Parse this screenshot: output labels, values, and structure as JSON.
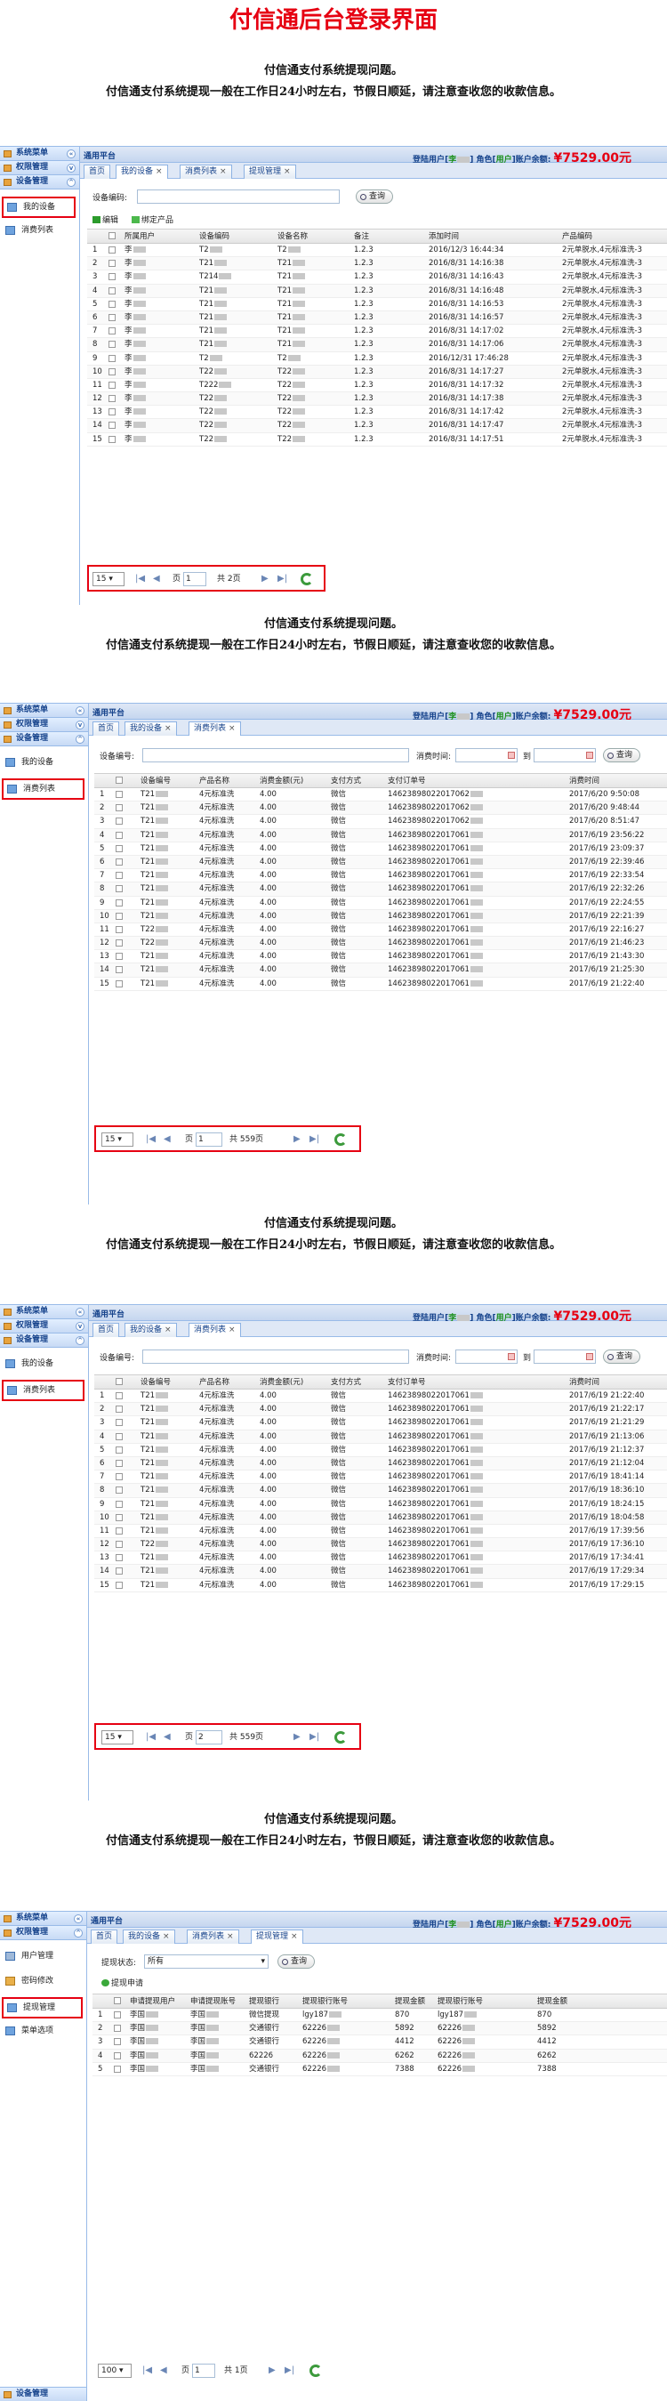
{
  "title": "付信通后台登录界面",
  "notice": {
    "line1": "付信通支付系统提现问题。",
    "line2": "付信通支付系统提现一般在工作日24小时左右，节假日顺延，请注意查收您的收款信息。"
  },
  "header": {
    "platform": "通用平台",
    "login_user_label": "登陆用户",
    "user_name": "李",
    "role_label": "角色",
    "role_name": "用户",
    "balance_label": "账户余额:",
    "balance": "¥7529.00",
    "currency_unit": "元"
  },
  "sidebar": {
    "system_menu": "系统菜单",
    "perm_mgmt": "权限管理",
    "device_mgmt": "设备管理",
    "my_devices": "我的设备",
    "consume_list": "消费列表",
    "user_mgmt": "用户管理",
    "pwd_change": "密码修改",
    "withdraw_mgmt": "提现管理",
    "menu_options": "菜单选项"
  },
  "tabs": {
    "home": "首页",
    "my_devices": "我的设备",
    "consume_list": "消费列表",
    "withdraw_mgmt": "提现管理"
  },
  "panel1": {
    "filter_label": "设备编码:",
    "query_btn": "查询",
    "edit_btn": "编辑",
    "bind_btn": "绑定产品",
    "columns": [
      "所属用户",
      "设备编码",
      "设备名称",
      "备注",
      "添加时间",
      "产品编码"
    ],
    "rows": [
      [
        "1",
        "李",
        "T2",
        "T2",
        "1.2.3",
        "2016/12/3 16:44:34",
        "2元单脱水,4元标准洗-3"
      ],
      [
        "2",
        "李",
        "T21",
        "T21",
        "1.2.3",
        "2016/8/31 14:16:38",
        "2元单脱水,4元标准洗-3"
      ],
      [
        "3",
        "李",
        "T214",
        "T21",
        "1.2.3",
        "2016/8/31 14:16:43",
        "2元单脱水,4元标准洗-3"
      ],
      [
        "4",
        "李",
        "T21",
        "T21",
        "1.2.3",
        "2016/8/31 14:16:48",
        "2元单脱水,4元标准洗-3"
      ],
      [
        "5",
        "李",
        "T21",
        "T21",
        "1.2.3",
        "2016/8/31 14:16:53",
        "2元单脱水,4元标准洗-3"
      ],
      [
        "6",
        "李",
        "T21",
        "T21",
        "1.2.3",
        "2016/8/31 14:16:57",
        "2元单脱水,4元标准洗-3"
      ],
      [
        "7",
        "李",
        "T21",
        "T21",
        "1.2.3",
        "2016/8/31 14:17:02",
        "2元单脱水,4元标准洗-3"
      ],
      [
        "8",
        "李",
        "T21",
        "T21",
        "1.2.3",
        "2016/8/31 14:17:06",
        "2元单脱水,4元标准洗-3"
      ],
      [
        "9",
        "李",
        "T2",
        "T2",
        "1.2.3",
        "2016/12/31 17:46:28",
        "2元单脱水,4元标准洗-3"
      ],
      [
        "10",
        "李",
        "T22",
        "T22",
        "1.2.3",
        "2016/8/31 14:17:27",
        "2元单脱水,4元标准洗-3"
      ],
      [
        "11",
        "李",
        "T222",
        "T22",
        "1.2.3",
        "2016/8/31 14:17:32",
        "2元单脱水,4元标准洗-3"
      ],
      [
        "12",
        "李",
        "T22",
        "T22",
        "1.2.3",
        "2016/8/31 14:17:38",
        "2元单脱水,4元标准洗-3"
      ],
      [
        "13",
        "李",
        "T22",
        "T22",
        "1.2.3",
        "2016/8/31 14:17:42",
        "2元单脱水,4元标准洗-3"
      ],
      [
        "14",
        "李",
        "T22",
        "T22",
        "1.2.3",
        "2016/8/31 14:17:47",
        "2元单脱水,4元标准洗-3"
      ],
      [
        "15",
        "李",
        "T22",
        "T22",
        "1.2.3",
        "2016/8/31 14:17:51",
        "2元单脱水,4元标准洗-3"
      ]
    ],
    "pager": {
      "size": "15",
      "page_label": "页",
      "page": "1",
      "total": "共 2页"
    }
  },
  "consume": {
    "filter_label": "设备编号:",
    "time_label": "消费时间:",
    "to_label": "到",
    "query_btn": "查询",
    "columns": [
      "设备编号",
      "产品名称",
      "消费金额(元)",
      "支付方式",
      "支付订单号",
      "消费时间"
    ]
  },
  "panel2": {
    "rows": [
      [
        "1",
        "T21",
        "4元标准洗",
        "4.00",
        "微信",
        "14623898022017062",
        "2017/6/20 9:50:08"
      ],
      [
        "2",
        "T21",
        "4元标准洗",
        "4.00",
        "微信",
        "14623898022017062",
        "2017/6/20 9:48:44"
      ],
      [
        "3",
        "T21",
        "4元标准洗",
        "4.00",
        "微信",
        "14623898022017062",
        "2017/6/20 8:51:47"
      ],
      [
        "4",
        "T21",
        "4元标准洗",
        "4.00",
        "微信",
        "14623898022017061",
        "2017/6/19 23:56:22"
      ],
      [
        "5",
        "T21",
        "4元标准洗",
        "4.00",
        "微信",
        "14623898022017061",
        "2017/6/19 23:09:37"
      ],
      [
        "6",
        "T21",
        "4元标准洗",
        "4.00",
        "微信",
        "14623898022017061",
        "2017/6/19 22:39:46"
      ],
      [
        "7",
        "T21",
        "4元标准洗",
        "4.00",
        "微信",
        "14623898022017061",
        "2017/6/19 22:33:54"
      ],
      [
        "8",
        "T21",
        "4元标准洗",
        "4.00",
        "微信",
        "14623898022017061",
        "2017/6/19 22:32:26"
      ],
      [
        "9",
        "T21",
        "4元标准洗",
        "4.00",
        "微信",
        "14623898022017061",
        "2017/6/19 22:24:55"
      ],
      [
        "10",
        "T21",
        "4元标准洗",
        "4.00",
        "微信",
        "14623898022017061",
        "2017/6/19 22:21:39"
      ],
      [
        "11",
        "T22",
        "4元标准洗",
        "4.00",
        "微信",
        "14623898022017061",
        "2017/6/19 22:16:27"
      ],
      [
        "12",
        "T22",
        "4元标准洗",
        "4.00",
        "微信",
        "14623898022017061",
        "2017/6/19 21:46:23"
      ],
      [
        "13",
        "T21",
        "4元标准洗",
        "4.00",
        "微信",
        "14623898022017061",
        "2017/6/19 21:43:30"
      ],
      [
        "14",
        "T21",
        "4元标准洗",
        "4.00",
        "微信",
        "14623898022017061",
        "2017/6/19 21:25:30"
      ],
      [
        "15",
        "T21",
        "4元标准洗",
        "4.00",
        "微信",
        "14623898022017061",
        "2017/6/19 21:22:40"
      ]
    ],
    "pager": {
      "size": "15",
      "page_label": "页",
      "page": "1",
      "total": "共 559页"
    }
  },
  "panel3": {
    "rows": [
      [
        "1",
        "T21",
        "4元标准洗",
        "4.00",
        "微信",
        "14623898022017061",
        "2017/6/19 21:22:40"
      ],
      [
        "2",
        "T21",
        "4元标准洗",
        "4.00",
        "微信",
        "14623898022017061",
        "2017/6/19 21:22:17"
      ],
      [
        "3",
        "T21",
        "4元标准洗",
        "4.00",
        "微信",
        "14623898022017061",
        "2017/6/19 21:21:29"
      ],
      [
        "4",
        "T21",
        "4元标准洗",
        "4.00",
        "微信",
        "14623898022017061",
        "2017/6/19 21:13:06"
      ],
      [
        "5",
        "T21",
        "4元标准洗",
        "4.00",
        "微信",
        "14623898022017061",
        "2017/6/19 21:12:37"
      ],
      [
        "6",
        "T21",
        "4元标准洗",
        "4.00",
        "微信",
        "14623898022017061",
        "2017/6/19 21:12:04"
      ],
      [
        "7",
        "T21",
        "4元标准洗",
        "4.00",
        "微信",
        "14623898022017061",
        "2017/6/19 18:41:14"
      ],
      [
        "8",
        "T21",
        "4元标准洗",
        "4.00",
        "微信",
        "14623898022017061",
        "2017/6/19 18:36:10"
      ],
      [
        "9",
        "T21",
        "4元标准洗",
        "4.00",
        "微信",
        "14623898022017061",
        "2017/6/19 18:24:15"
      ],
      [
        "10",
        "T21",
        "4元标准洗",
        "4.00",
        "微信",
        "14623898022017061",
        "2017/6/19 18:04:58"
      ],
      [
        "11",
        "T21",
        "4元标准洗",
        "4.00",
        "微信",
        "14623898022017061",
        "2017/6/19 17:39:56"
      ],
      [
        "12",
        "T22",
        "4元标准洗",
        "4.00",
        "微信",
        "14623898022017061",
        "2017/6/19 17:36:10"
      ],
      [
        "13",
        "T21",
        "4元标准洗",
        "4.00",
        "微信",
        "14623898022017061",
        "2017/6/19 17:34:41"
      ],
      [
        "14",
        "T21",
        "4元标准洗",
        "4.00",
        "微信",
        "14623898022017061",
        "2017/6/19 17:29:34"
      ],
      [
        "15",
        "T21",
        "4元标准洗",
        "4.00",
        "微信",
        "14623898022017061",
        "2017/6/19 17:29:15"
      ]
    ],
    "pager": {
      "size": "15",
      "page_label": "页",
      "page": "2",
      "total": "共 559页"
    }
  },
  "panel4": {
    "filter_label": "提现状态:",
    "filter_value": "所有",
    "query_btn": "查询",
    "apply_btn": "提现申请",
    "columns": [
      "申请提现用户",
      "申请提现账号",
      "提现银行",
      "提现银行账号",
      "提现金额",
      "提现银行账号",
      "提现金额"
    ],
    "rows": [
      [
        "1",
        "李国",
        "李国",
        "微信提现",
        "lgy187",
        "870",
        "lgy187",
        "870"
      ],
      [
        "2",
        "李国",
        "李国",
        "交通银行",
        "62226",
        "5892",
        "62226",
        "5892"
      ],
      [
        "3",
        "李国",
        "李国",
        "交通银行",
        "62226",
        "4412",
        "62226",
        "4412"
      ],
      [
        "4",
        "李国",
        "李国",
        "62226",
        "62226",
        "6262",
        "62226",
        "6262"
      ],
      [
        "5",
        "李国",
        "李国",
        "交通银行",
        "62226",
        "7388",
        "62226",
        "7388"
      ]
    ],
    "pager": {
      "size": "100",
      "page_label": "页",
      "page": "1",
      "total": "共 1页"
    }
  },
  "colors": {
    "accent_red": "#e60012",
    "nav_blue": "#15428b"
  }
}
